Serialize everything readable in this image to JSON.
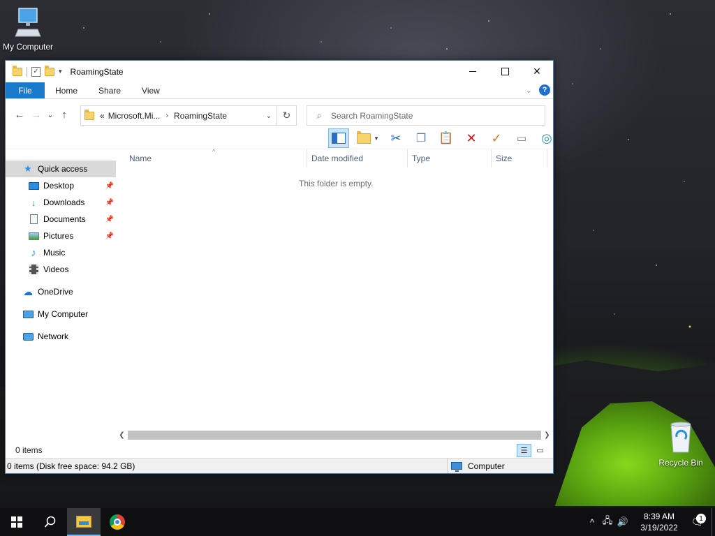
{
  "desktop": {
    "icons": [
      {
        "label": "My Computer",
        "icon": "computer-icon"
      },
      {
        "label": "Recycle Bin",
        "icon": "recycle-bin-icon"
      }
    ]
  },
  "window": {
    "title": "RoamingState",
    "ribbon_tabs": [
      "File",
      "Home",
      "Share",
      "View"
    ],
    "nav": {
      "back": "←",
      "forward": "→",
      "recent": "⌄",
      "up": "↑"
    },
    "address": {
      "overflow": "«",
      "crumbs": [
        "Microsoft.Mi...",
        "RoamingState"
      ],
      "separator": "›",
      "refresh": "↻"
    },
    "search": {
      "placeholder": "Search RoamingState"
    },
    "sidebar": {
      "quick_access": "Quick access",
      "items": [
        {
          "label": "Desktop",
          "icon": "desktop-icon",
          "pinned": true
        },
        {
          "label": "Downloads",
          "icon": "downloads-icon",
          "pinned": true
        },
        {
          "label": "Documents",
          "icon": "documents-icon",
          "pinned": true
        },
        {
          "label": "Pictures",
          "icon": "pictures-icon",
          "pinned": true
        },
        {
          "label": "Music",
          "icon": "music-icon",
          "pinned": false
        },
        {
          "label": "Videos",
          "icon": "videos-icon",
          "pinned": false
        }
      ],
      "onedrive": "OneDrive",
      "my_computer": "My Computer",
      "network": "Network"
    },
    "columns": [
      "Name",
      "Date modified",
      "Type",
      "Size"
    ],
    "empty_message": "This folder is empty.",
    "item_count": "0 items",
    "status": {
      "left": "0 items (Disk free space: 94.2 GB)",
      "right": "Computer"
    }
  },
  "taskbar": {
    "time": "8:39 AM",
    "date": "3/19/2022",
    "notification_count": "1"
  },
  "colors": {
    "file_tab": "#1979ca",
    "selection": "#cce4f7",
    "taskbar": "#101012"
  }
}
